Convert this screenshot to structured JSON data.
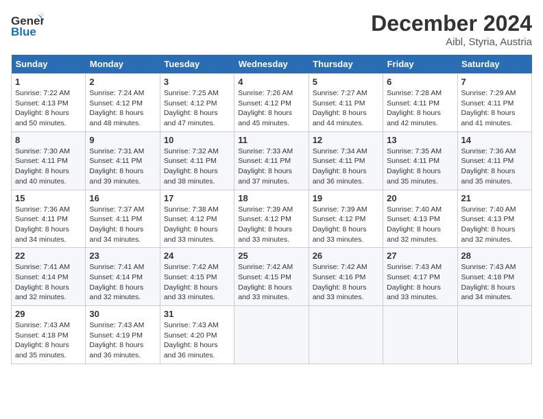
{
  "header": {
    "logo_line1": "General",
    "logo_line2": "Blue",
    "month_year": "December 2024",
    "location": "Aibl, Styria, Austria"
  },
  "weekdays": [
    "Sunday",
    "Monday",
    "Tuesday",
    "Wednesday",
    "Thursday",
    "Friday",
    "Saturday"
  ],
  "weeks": [
    [
      {
        "day": "1",
        "sunrise": "Sunrise: 7:22 AM",
        "sunset": "Sunset: 4:13 PM",
        "daylight": "Daylight: 8 hours and 50 minutes."
      },
      {
        "day": "2",
        "sunrise": "Sunrise: 7:24 AM",
        "sunset": "Sunset: 4:12 PM",
        "daylight": "Daylight: 8 hours and 48 minutes."
      },
      {
        "day": "3",
        "sunrise": "Sunrise: 7:25 AM",
        "sunset": "Sunset: 4:12 PM",
        "daylight": "Daylight: 8 hours and 47 minutes."
      },
      {
        "day": "4",
        "sunrise": "Sunrise: 7:26 AM",
        "sunset": "Sunset: 4:12 PM",
        "daylight": "Daylight: 8 hours and 45 minutes."
      },
      {
        "day": "5",
        "sunrise": "Sunrise: 7:27 AM",
        "sunset": "Sunset: 4:11 PM",
        "daylight": "Daylight: 8 hours and 44 minutes."
      },
      {
        "day": "6",
        "sunrise": "Sunrise: 7:28 AM",
        "sunset": "Sunset: 4:11 PM",
        "daylight": "Daylight: 8 hours and 42 minutes."
      },
      {
        "day": "7",
        "sunrise": "Sunrise: 7:29 AM",
        "sunset": "Sunset: 4:11 PM",
        "daylight": "Daylight: 8 hours and 41 minutes."
      }
    ],
    [
      {
        "day": "8",
        "sunrise": "Sunrise: 7:30 AM",
        "sunset": "Sunset: 4:11 PM",
        "daylight": "Daylight: 8 hours and 40 minutes."
      },
      {
        "day": "9",
        "sunrise": "Sunrise: 7:31 AM",
        "sunset": "Sunset: 4:11 PM",
        "daylight": "Daylight: 8 hours and 39 minutes."
      },
      {
        "day": "10",
        "sunrise": "Sunrise: 7:32 AM",
        "sunset": "Sunset: 4:11 PM",
        "daylight": "Daylight: 8 hours and 38 minutes."
      },
      {
        "day": "11",
        "sunrise": "Sunrise: 7:33 AM",
        "sunset": "Sunset: 4:11 PM",
        "daylight": "Daylight: 8 hours and 37 minutes."
      },
      {
        "day": "12",
        "sunrise": "Sunrise: 7:34 AM",
        "sunset": "Sunset: 4:11 PM",
        "daylight": "Daylight: 8 hours and 36 minutes."
      },
      {
        "day": "13",
        "sunrise": "Sunrise: 7:35 AM",
        "sunset": "Sunset: 4:11 PM",
        "daylight": "Daylight: 8 hours and 35 minutes."
      },
      {
        "day": "14",
        "sunrise": "Sunrise: 7:36 AM",
        "sunset": "Sunset: 4:11 PM",
        "daylight": "Daylight: 8 hours and 35 minutes."
      }
    ],
    [
      {
        "day": "15",
        "sunrise": "Sunrise: 7:36 AM",
        "sunset": "Sunset: 4:11 PM",
        "daylight": "Daylight: 8 hours and 34 minutes."
      },
      {
        "day": "16",
        "sunrise": "Sunrise: 7:37 AM",
        "sunset": "Sunset: 4:11 PM",
        "daylight": "Daylight: 8 hours and 34 minutes."
      },
      {
        "day": "17",
        "sunrise": "Sunrise: 7:38 AM",
        "sunset": "Sunset: 4:12 PM",
        "daylight": "Daylight: 8 hours and 33 minutes."
      },
      {
        "day": "18",
        "sunrise": "Sunrise: 7:39 AM",
        "sunset": "Sunset: 4:12 PM",
        "daylight": "Daylight: 8 hours and 33 minutes."
      },
      {
        "day": "19",
        "sunrise": "Sunrise: 7:39 AM",
        "sunset": "Sunset: 4:12 PM",
        "daylight": "Daylight: 8 hours and 33 minutes."
      },
      {
        "day": "20",
        "sunrise": "Sunrise: 7:40 AM",
        "sunset": "Sunset: 4:13 PM",
        "daylight": "Daylight: 8 hours and 32 minutes."
      },
      {
        "day": "21",
        "sunrise": "Sunrise: 7:40 AM",
        "sunset": "Sunset: 4:13 PM",
        "daylight": "Daylight: 8 hours and 32 minutes."
      }
    ],
    [
      {
        "day": "22",
        "sunrise": "Sunrise: 7:41 AM",
        "sunset": "Sunset: 4:14 PM",
        "daylight": "Daylight: 8 hours and 32 minutes."
      },
      {
        "day": "23",
        "sunrise": "Sunrise: 7:41 AM",
        "sunset": "Sunset: 4:14 PM",
        "daylight": "Daylight: 8 hours and 32 minutes."
      },
      {
        "day": "24",
        "sunrise": "Sunrise: 7:42 AM",
        "sunset": "Sunset: 4:15 PM",
        "daylight": "Daylight: 8 hours and 33 minutes."
      },
      {
        "day": "25",
        "sunrise": "Sunrise: 7:42 AM",
        "sunset": "Sunset: 4:15 PM",
        "daylight": "Daylight: 8 hours and 33 minutes."
      },
      {
        "day": "26",
        "sunrise": "Sunrise: 7:42 AM",
        "sunset": "Sunset: 4:16 PM",
        "daylight": "Daylight: 8 hours and 33 minutes."
      },
      {
        "day": "27",
        "sunrise": "Sunrise: 7:43 AM",
        "sunset": "Sunset: 4:17 PM",
        "daylight": "Daylight: 8 hours and 33 minutes."
      },
      {
        "day": "28",
        "sunrise": "Sunrise: 7:43 AM",
        "sunset": "Sunset: 4:18 PM",
        "daylight": "Daylight: 8 hours and 34 minutes."
      }
    ],
    [
      {
        "day": "29",
        "sunrise": "Sunrise: 7:43 AM",
        "sunset": "Sunset: 4:18 PM",
        "daylight": "Daylight: 8 hours and 35 minutes."
      },
      {
        "day": "30",
        "sunrise": "Sunrise: 7:43 AM",
        "sunset": "Sunset: 4:19 PM",
        "daylight": "Daylight: 8 hours and 36 minutes."
      },
      {
        "day": "31",
        "sunrise": "Sunrise: 7:43 AM",
        "sunset": "Sunset: 4:20 PM",
        "daylight": "Daylight: 8 hours and 36 minutes."
      },
      null,
      null,
      null,
      null
    ]
  ]
}
